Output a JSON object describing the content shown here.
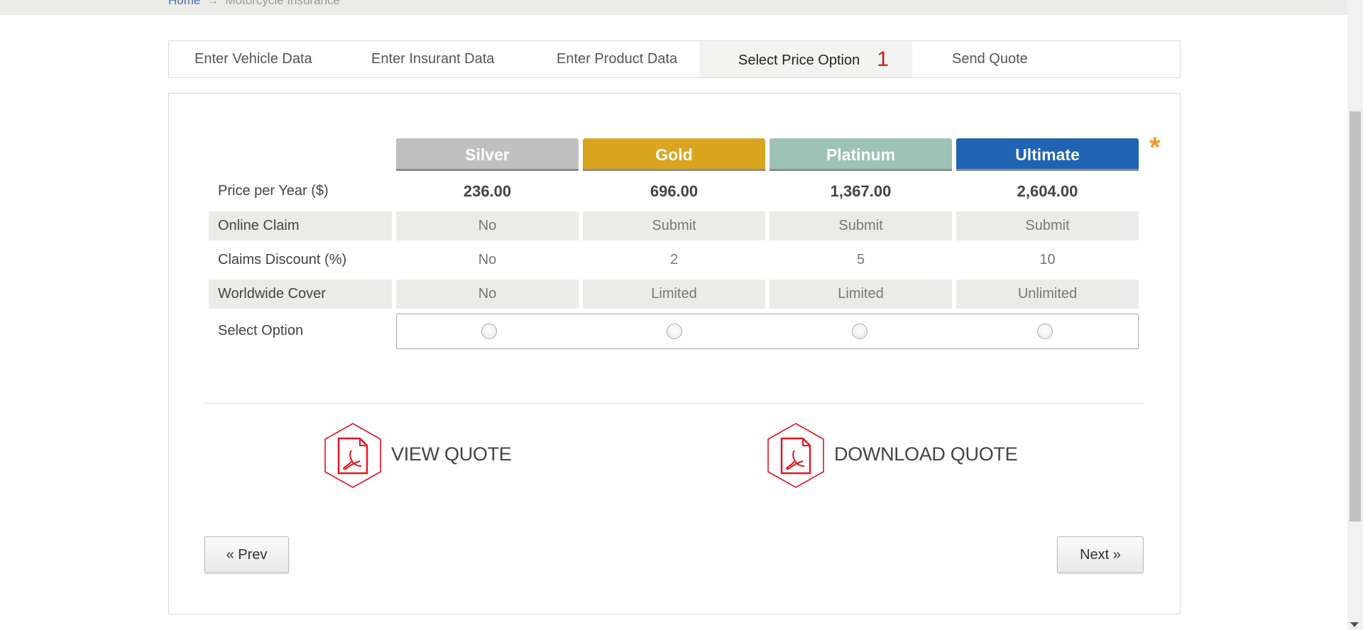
{
  "breadcrumb": {
    "home": "Home",
    "separator": "→",
    "current": "Motorcycle Insurance"
  },
  "tabs": [
    {
      "label": "Enter Vehicle Data"
    },
    {
      "label": "Enter Insurant Data"
    },
    {
      "label": "Enter Product Data"
    },
    {
      "label": "Select Price Option",
      "badge": "1",
      "active": true
    },
    {
      "label": "Send Quote"
    }
  ],
  "plans": [
    {
      "name": "Silver",
      "color": "#c0c0c0"
    },
    {
      "name": "Gold",
      "color": "#daa520"
    },
    {
      "name": "Platinum",
      "color": "#9dc2b6"
    },
    {
      "name": "Ultimate",
      "color": "#1f63b3"
    }
  ],
  "required_marker": "*",
  "rows": {
    "price": {
      "label": "Price per Year ($)",
      "values": [
        "236.00",
        "696.00",
        "1,367.00",
        "2,604.00"
      ]
    },
    "online_claim": {
      "label": "Online Claim",
      "values": [
        "No",
        "Submit",
        "Submit",
        "Submit"
      ]
    },
    "claims_discount": {
      "label": "Claims Discount (%)",
      "values": [
        "No",
        "2",
        "5",
        "10"
      ]
    },
    "worldwide_cover": {
      "label": "Worldwide Cover",
      "values": [
        "No",
        "Limited",
        "Limited",
        "Unlimited"
      ]
    },
    "select_option": {
      "label": "Select Option"
    }
  },
  "actions": {
    "view_quote": "VIEW QUOTE",
    "download_quote": "DOWNLOAD QUOTE"
  },
  "nav": {
    "prev": "« Prev",
    "next": "Next »"
  },
  "colors": {
    "pdf_red": "#e0141e",
    "badge_red": "#cc1d1d",
    "star_orange": "#f29a2e"
  }
}
